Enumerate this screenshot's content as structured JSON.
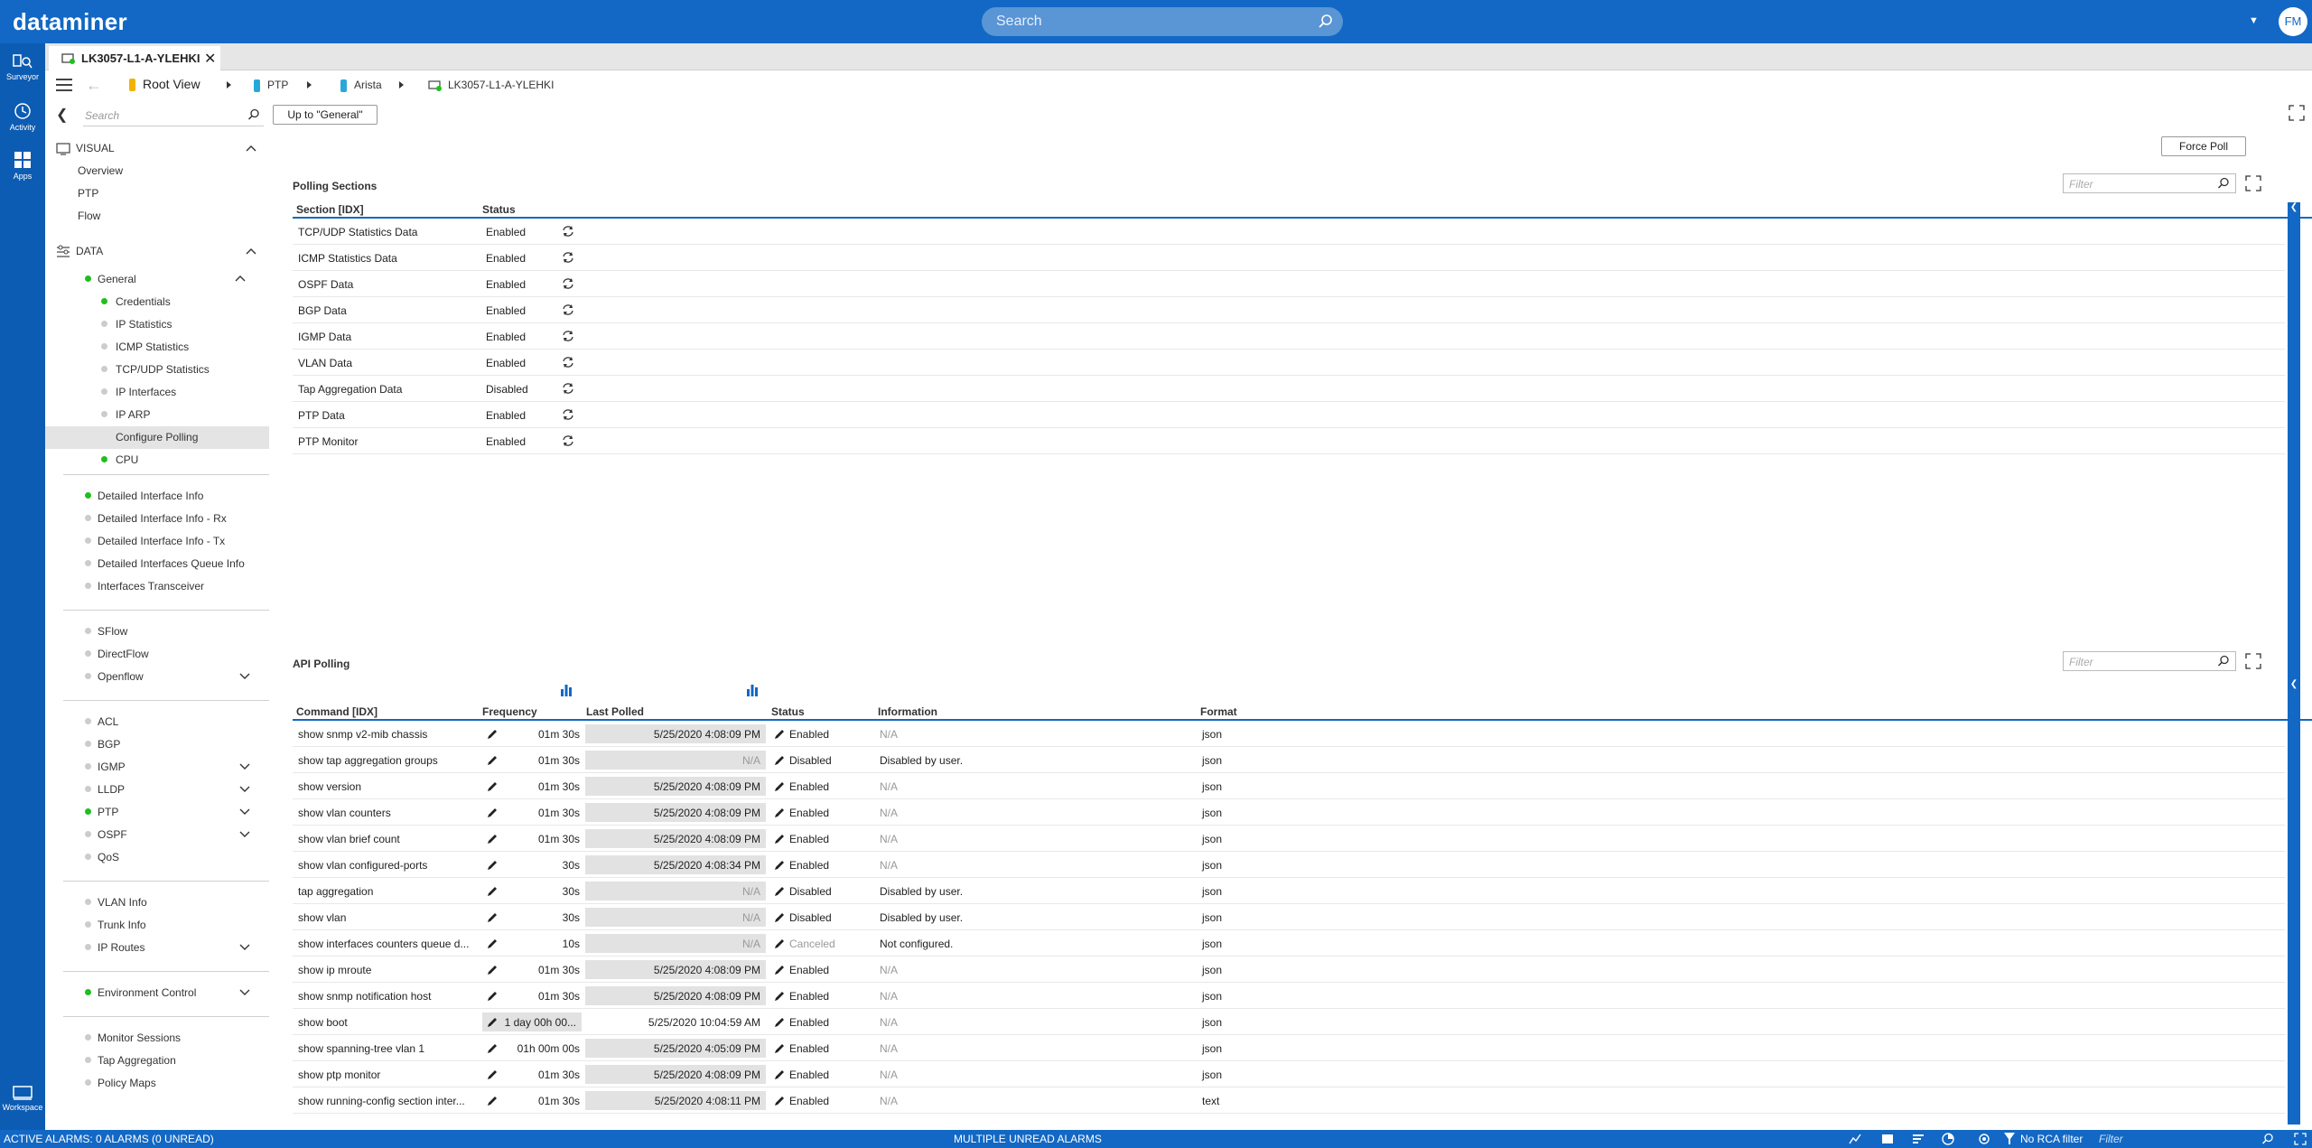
{
  "header": {
    "logo": "dataminer",
    "search_placeholder": "Search",
    "avatar": "FM"
  },
  "nav": [
    {
      "label": "Surveyor",
      "icon": "surveyor-icon"
    },
    {
      "label": "Activity",
      "icon": "activity-icon"
    },
    {
      "label": "Apps",
      "icon": "apps-icon"
    },
    {
      "label": "Workspace",
      "icon": "workspace-icon"
    }
  ],
  "tab": {
    "title": "LK3057-L1-A-YLEHKI"
  },
  "breadcrumb": [
    "Root View",
    "PTP",
    "Arista",
    "LK3057-L1-A-YLEHKI"
  ],
  "sidebar": {
    "search_placeholder": "Search",
    "visual_head": "VISUAL",
    "visual_items": [
      "Overview",
      "PTP",
      "Flow"
    ],
    "data_head": "DATA",
    "general": "General",
    "general_items": [
      {
        "label": "Credentials",
        "status": "green"
      },
      {
        "label": "IP Statistics",
        "status": "grey"
      },
      {
        "label": "ICMP Statistics",
        "status": "grey"
      },
      {
        "label": "TCP/UDP Statistics",
        "status": "grey"
      },
      {
        "label": "IP Interfaces",
        "status": "grey"
      },
      {
        "label": "IP ARP",
        "status": "grey"
      },
      {
        "label": "Configure Polling",
        "status": "none"
      },
      {
        "label": "CPU",
        "status": "green"
      }
    ],
    "groups": [
      [
        {
          "label": "Detailed Interface Info",
          "status": "green"
        },
        {
          "label": "Detailed Interface Info - Rx",
          "status": "grey"
        },
        {
          "label": "Detailed Interface Info - Tx",
          "status": "grey"
        },
        {
          "label": "Detailed Interfaces Queue Info",
          "status": "grey"
        },
        {
          "label": "Interfaces Transceiver",
          "status": "grey"
        }
      ],
      [
        {
          "label": "SFlow",
          "status": "grey"
        },
        {
          "label": "DirectFlow",
          "status": "grey"
        },
        {
          "label": "Openflow",
          "status": "grey",
          "chevron": true
        }
      ],
      [
        {
          "label": "ACL",
          "status": "grey"
        },
        {
          "label": "BGP",
          "status": "grey"
        },
        {
          "label": "IGMP",
          "status": "grey",
          "chevron": true
        },
        {
          "label": "LLDP",
          "status": "grey",
          "chevron": true
        },
        {
          "label": "PTP",
          "status": "green",
          "chevron": true
        },
        {
          "label": "OSPF",
          "status": "grey",
          "chevron": true
        },
        {
          "label": "QoS",
          "status": "grey"
        }
      ],
      [
        {
          "label": "VLAN Info",
          "status": "grey"
        },
        {
          "label": "Trunk Info",
          "status": "grey"
        },
        {
          "label": "IP Routes",
          "status": "grey",
          "chevron": true
        }
      ],
      [
        {
          "label": "Environment Control",
          "status": "green",
          "chevron": true
        }
      ],
      [
        {
          "label": "Monitor Sessions",
          "status": "grey"
        },
        {
          "label": "Tap Aggregation",
          "status": "grey"
        },
        {
          "label": "Policy Maps",
          "status": "grey"
        }
      ]
    ]
  },
  "main": {
    "up_button": "Up to \"General\"",
    "force_poll": "Force Poll",
    "filter_placeholder": "Filter",
    "polling": {
      "title": "Polling Sections",
      "columns": [
        "Section [IDX]",
        "Status"
      ],
      "rows": [
        {
          "section": "TCP/UDP Statistics Data",
          "status": "Enabled"
        },
        {
          "section": "ICMP Statistics Data",
          "status": "Enabled"
        },
        {
          "section": "OSPF Data",
          "status": "Enabled"
        },
        {
          "section": "BGP Data",
          "status": "Enabled"
        },
        {
          "section": "IGMP Data",
          "status": "Enabled"
        },
        {
          "section": "VLAN Data",
          "status": "Enabled"
        },
        {
          "section": "Tap Aggregation Data",
          "status": "Disabled"
        },
        {
          "section": "PTP Data",
          "status": "Enabled"
        },
        {
          "section": "PTP Monitor",
          "status": "Enabled"
        }
      ]
    },
    "api": {
      "title": "API Polling",
      "columns": [
        "Command [IDX]",
        "Frequency",
        "Last Polled",
        "Status",
        "Information",
        "Format"
      ],
      "rows": [
        {
          "command": "show snmp v2-mib chassis",
          "frequency": "01m 30s",
          "last_polled": "5/25/2020 4:08:09 PM",
          "status": "Enabled",
          "info": "N/A",
          "format": "json"
        },
        {
          "command": "show tap aggregation groups",
          "frequency": "01m 30s",
          "last_polled": "N/A",
          "status": "Disabled",
          "info": "Disabled by user.",
          "format": "json"
        },
        {
          "command": "show version",
          "frequency": "01m 30s",
          "last_polled": "5/25/2020 4:08:09 PM",
          "status": "Enabled",
          "info": "N/A",
          "format": "json"
        },
        {
          "command": "show vlan counters",
          "frequency": "01m 30s",
          "last_polled": "5/25/2020 4:08:09 PM",
          "status": "Enabled",
          "info": "N/A",
          "format": "json"
        },
        {
          "command": "show vlan brief count",
          "frequency": "01m 30s",
          "last_polled": "5/25/2020 4:08:09 PM",
          "status": "Enabled",
          "info": "N/A",
          "format": "json"
        },
        {
          "command": "show vlan configured-ports",
          "frequency": "30s",
          "last_polled": "5/25/2020 4:08:34 PM",
          "status": "Enabled",
          "info": "N/A",
          "format": "json"
        },
        {
          "command": "tap aggregation",
          "frequency": "30s",
          "last_polled": "N/A",
          "status": "Disabled",
          "info": "Disabled by user.",
          "format": "json"
        },
        {
          "command": "show vlan",
          "frequency": "30s",
          "last_polled": "N/A",
          "status": "Disabled",
          "info": "Disabled by user.",
          "format": "json"
        },
        {
          "command": "show interfaces counters queue d...",
          "frequency": "10s",
          "last_polled": "N/A",
          "status": "Canceled",
          "info": "Not configured.",
          "format": "json"
        },
        {
          "command": "show ip mroute",
          "frequency": "01m 30s",
          "last_polled": "5/25/2020 4:08:09 PM",
          "status": "Enabled",
          "info": "N/A",
          "format": "json"
        },
        {
          "command": "show snmp notification host",
          "frequency": "01m 30s",
          "last_polled": "5/25/2020 4:08:09 PM",
          "status": "Enabled",
          "info": "N/A",
          "format": "json"
        },
        {
          "command": "show boot",
          "frequency": "1 day 00h 00...",
          "last_polled": "5/25/2020 10:04:59 AM",
          "status": "Enabled",
          "info": "N/A",
          "format": "json",
          "freq_box": true,
          "plain_lp": true
        },
        {
          "command": "show spanning-tree vlan 1",
          "frequency": "01h 00m 00s",
          "last_polled": "5/25/2020 4:05:09 PM",
          "status": "Enabled",
          "info": "N/A",
          "format": "json"
        },
        {
          "command": "show ptp monitor",
          "frequency": "01m 30s",
          "last_polled": "5/25/2020 4:08:09 PM",
          "status": "Enabled",
          "info": "N/A",
          "format": "json"
        },
        {
          "command": "show running-config section inter...",
          "frequency": "01m 30s",
          "last_polled": "5/25/2020 4:08:11 PM",
          "status": "Enabled",
          "info": "N/A",
          "format": "text"
        }
      ]
    }
  },
  "statusbar": {
    "alarms": "ACTIVE ALARMS: 0 ALARMS (0 UNREAD)",
    "center": "MULTIPLE UNREAD ALARMS",
    "rca": "No RCA filter",
    "filter": "Filter"
  },
  "colors": {
    "brand": "#1268c4",
    "status_ok": "#1fbf1f"
  }
}
